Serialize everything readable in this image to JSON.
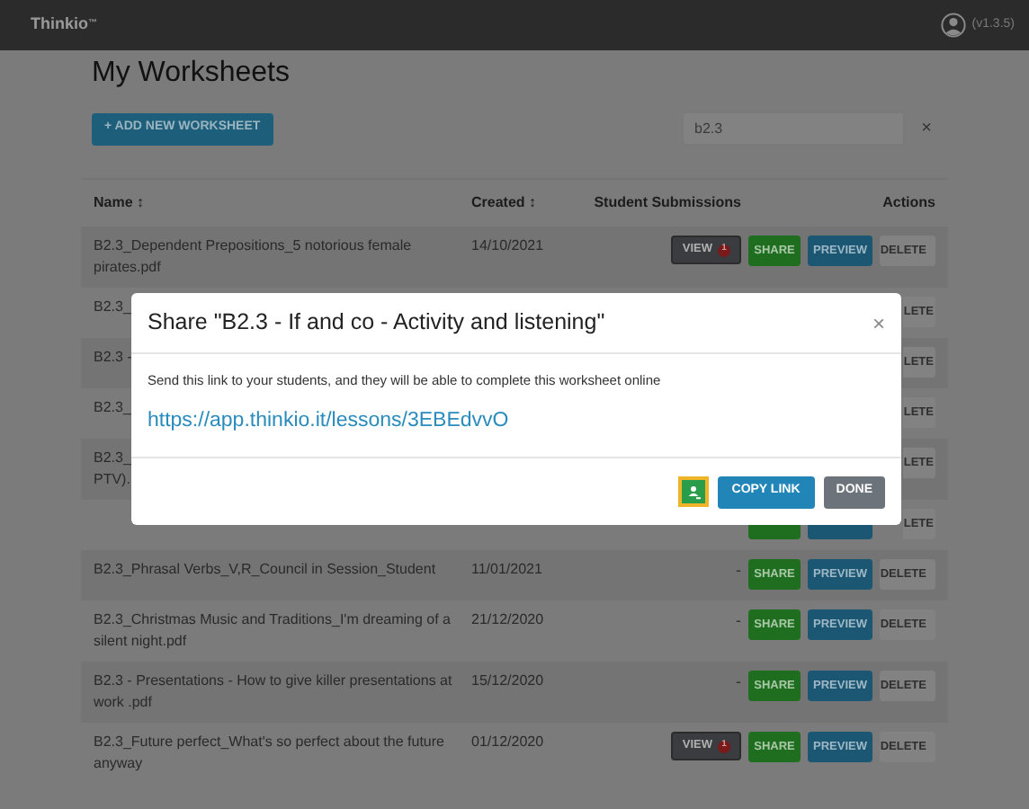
{
  "header": {
    "brand": "Thinkio",
    "brand_mark": "™",
    "version": "(v1.3.5)"
  },
  "page": {
    "title": "My Worksheets",
    "add_button": "+ ADD NEW WORKSHEET",
    "search": {
      "value": "b2.3"
    },
    "clear": "×"
  },
  "table": {
    "columns": [
      {
        "label": "Name",
        "sort_icon": "↕"
      },
      {
        "label": "Created",
        "sort_icon": "↕"
      },
      {
        "label": "Student Submissions"
      },
      {
        "label": "Actions"
      }
    ],
    "rows": [
      {
        "name": "B2.3_Dependent Prepositions_5 notorious female pirates.pdf",
        "created": "14/10/2021",
        "submissions": {
          "kind": "view",
          "label": "VIEW",
          "badge": "1"
        },
        "actions": [
          {
            "kind": "share",
            "label": "SHARE"
          },
          {
            "kind": "preview",
            "label": "PREVIEW"
          },
          {
            "kind": "delete",
            "label": "DELETE"
          }
        ]
      },
      {
        "name": "B2.3_",
        "actions": [
          {
            "kind": "delete",
            "label": "LETE",
            "clipped": true
          }
        ]
      },
      {
        "name": "B2.3 -",
        "actions": [
          {
            "kind": "delete",
            "label": "LETE",
            "clipped": true
          }
        ]
      },
      {
        "name": "B2.3_",
        "actions": [
          {
            "kind": "delete",
            "label": "LETE",
            "clipped": true
          }
        ]
      },
      {
        "name": "B2.3_\nPTV).",
        "actions": [
          {
            "kind": "delete",
            "label": "LETE",
            "clipped": true
          }
        ]
      },
      {
        "actions": [
          {
            "kind": "share"
          },
          {
            "kind": "preview"
          },
          {
            "kind": "delete",
            "label": "LETE",
            "clipped": true
          }
        ]
      },
      {
        "name": "B2.3_Phrasal Verbs_V,R_Council in Session_Student",
        "created": "11/01/2021",
        "submissions": {
          "kind": "none",
          "label": "-"
        },
        "actions": [
          {
            "kind": "share",
            "label": "SHARE"
          },
          {
            "kind": "preview",
            "label": "PREVIEW"
          },
          {
            "kind": "delete",
            "label": "DELETE"
          }
        ]
      },
      {
        "name": "B2.3_Christmas Music and Traditions_I'm dreaming of a silent night.pdf",
        "created": "21/12/2020",
        "submissions": {
          "kind": "none",
          "label": "-"
        },
        "actions": [
          {
            "kind": "share",
            "label": "SHARE"
          },
          {
            "kind": "preview",
            "label": "PREVIEW"
          },
          {
            "kind": "delete",
            "label": "DELETE"
          }
        ]
      },
      {
        "name": "B2.3 - Presentations - How to give killer presentations at work .pdf",
        "created": "15/12/2020",
        "submissions": {
          "kind": "none",
          "label": "-"
        },
        "actions": [
          {
            "kind": "share",
            "label": "SHARE"
          },
          {
            "kind": "preview",
            "label": "PREVIEW"
          },
          {
            "kind": "delete",
            "label": "DELETE"
          }
        ]
      },
      {
        "name": "B2.3_Future perfect_What's so perfect about the future anyway",
        "created": "01/12/2020",
        "submissions": {
          "kind": "view",
          "label": "VIEW",
          "badge": "1"
        },
        "actions": [
          {
            "kind": "share",
            "label": "SHARE"
          },
          {
            "kind": "preview",
            "label": "PREVIEW"
          },
          {
            "kind": "delete",
            "label": "DELETE"
          }
        ]
      }
    ]
  },
  "modal": {
    "title": "Share \"B2.3 - If and co - Activity and listening\"",
    "close": "×",
    "message": "Send this link to your students, and they will be able to complete this worksheet online",
    "link": "https://app.thinkio.it/lessons/3EBEdvvO",
    "buttons": [
      {
        "kind": "classroom"
      },
      {
        "kind": "primary",
        "label": "COPY LINK"
      },
      {
        "kind": "secondary",
        "label": "DONE"
      }
    ]
  }
}
